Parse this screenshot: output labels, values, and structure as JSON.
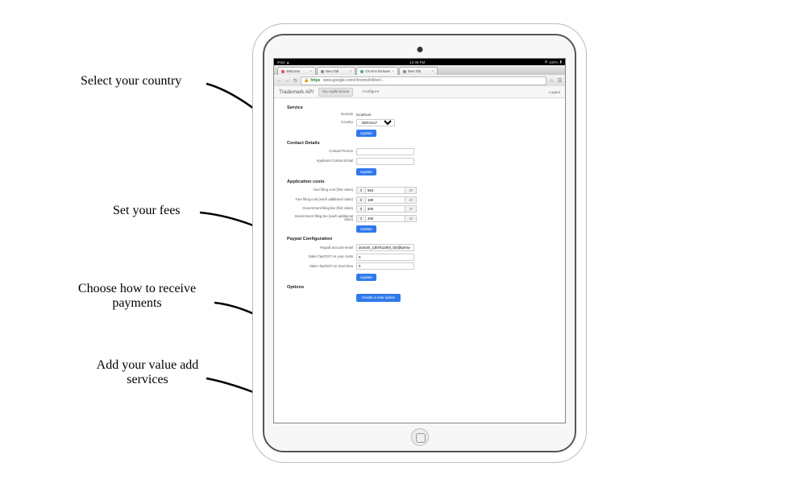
{
  "status_bar": {
    "carrier": "iPad",
    "time": "12:49 PM",
    "battery": "100%"
  },
  "browser": {
    "tabs": [
      {
        "label": "Welcome"
      },
      {
        "label": "New Tab"
      },
      {
        "label": "Chrome Browser"
      },
      {
        "label": "New Tab"
      }
    ],
    "url_scheme": "https",
    "url_host": "www.google.com",
    "url_path": "/chrome/intl/en/..."
  },
  "app": {
    "brand": "Trademark API",
    "tabs": [
      {
        "label": "My Applications",
        "active": true
      },
      {
        "label": "Configure",
        "active": false
      }
    ],
    "logout": "Logout"
  },
  "service": {
    "heading": "Service",
    "domain_label": "Domain",
    "domain_value": "localhost",
    "country_label": "Country",
    "country_value": "DEFAULT",
    "update": "Update"
  },
  "contact": {
    "heading": "Contact Details",
    "person_label": "Contact Person",
    "person_value": "",
    "email_label": "Applicant Contact Email",
    "email_value": "",
    "update": "Update"
  },
  "costs": {
    "heading": "Application costs",
    "currency": "$",
    "cents": ".00",
    "rows": [
      {
        "label": "Your filing cost (first class)",
        "value": "554"
      },
      {
        "label": "Your filing cost (each additional class)",
        "value": "180"
      },
      {
        "label": "Government filing fee (first class)",
        "value": "200"
      },
      {
        "label": "Government filing fee (each additional class)",
        "value": "200"
      }
    ],
    "update": "Update"
  },
  "paypal": {
    "heading": "Paypal Configuration",
    "email_label": "Paypal account email",
    "email_value": "domain_1357611064_biz@tpmsv",
    "tax_costs_label": "Sales Tax/GST on your costs",
    "tax_costs_value": "0",
    "tax_govt_label": "Sales Tax/GST on Govt fees",
    "tax_govt_value": "0",
    "update": "Update"
  },
  "options": {
    "heading": "Options",
    "create": "Create a new option"
  },
  "annotations": {
    "a1": "Select your country",
    "a2": "Set your fees",
    "a3": "Choose how to receive payments",
    "a4": "Add your value add services"
  }
}
